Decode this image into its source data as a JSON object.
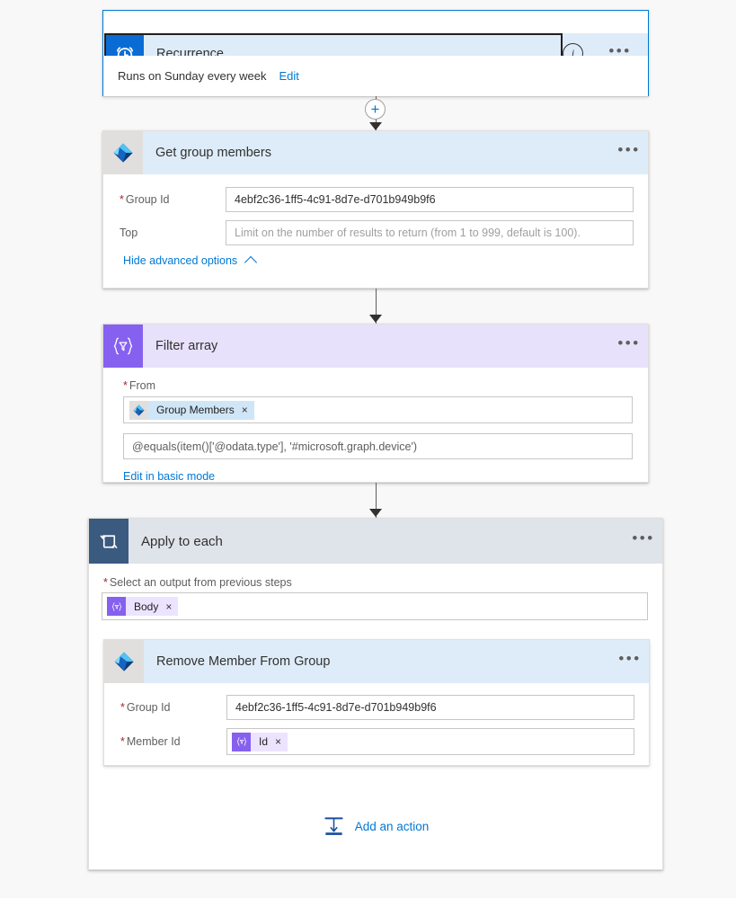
{
  "flow": {
    "trigger": {
      "icon": "alarm-clock-icon",
      "title": "Recurrence",
      "subtitle": "Runs on Sunday every week",
      "edit_label": "Edit",
      "info_glyph": "i",
      "more_glyph": "•••",
      "accent_color": "#0b6bd4",
      "header_bg": "#deecf9",
      "border_color": "#0078d4"
    },
    "connector_plus": {
      "glyph": "+",
      "color": "#0078d4"
    },
    "actions": [
      {
        "id": "get_group_members",
        "icon": "office365-groups-diamond-icon",
        "title": "Get group members",
        "header_bg": "#deecf9",
        "icon_bg": "#e1dfdd",
        "more_glyph": "•••",
        "fields": [
          {
            "label": "Group Id",
            "required": true,
            "value": "4ebf2c36-1ff5-4c91-8d7e-d701b949b9f6",
            "placeholder": ""
          },
          {
            "label": "Top",
            "required": false,
            "value": "",
            "placeholder": "Limit on the number of results to return (from 1 to 999, default is 100)."
          }
        ],
        "advanced_link": "Hide advanced options",
        "advanced_chevron": "chevron-up-icon"
      },
      {
        "id": "filter_array",
        "icon": "filter-braces-icon",
        "title": "Filter array",
        "header_bg": "#e8e1fb",
        "icon_bg": "#8661f0",
        "more_glyph": "•••",
        "from_label": "From",
        "from_required": true,
        "from_token": {
          "text": "Group Members",
          "remove_glyph": "×",
          "style": "blue",
          "icon": "office365-groups-diamond-icon"
        },
        "expression": "@equals(item()['@odata.type'], '#microsoft.graph.device')",
        "basic_mode_link": "Edit in basic mode"
      },
      {
        "id": "apply_to_each",
        "icon": "loop-arrows-icon",
        "title": "Apply to each",
        "header_bg": "#dfe3ea",
        "icon_bg": "#3b5a80",
        "more_glyph": "•••",
        "select_label": "Select an output from previous steps",
        "select_required": true,
        "select_token": {
          "text": "Body",
          "remove_glyph": "×",
          "style": "purple",
          "icon": "filter-braces-icon"
        },
        "nested_action": {
          "id": "remove_member_from_group",
          "icon": "office365-groups-diamond-icon",
          "title": "Remove Member From Group",
          "header_bg": "#deecf9",
          "icon_bg": "#e1dfdd",
          "more_glyph": "•••",
          "fields": [
            {
              "label": "Group Id",
              "required": true,
              "value": "4ebf2c36-1ff5-4c91-8d7e-d701b949b9f6",
              "placeholder": ""
            },
            {
              "label": "Member Id",
              "required": true,
              "token": {
                "text": "Id",
                "remove_glyph": "×",
                "style": "purple",
                "icon": "filter-braces-icon"
              }
            }
          ]
        },
        "add_action": {
          "label": "Add an action",
          "icon": "insert-action-icon",
          "color": "#0078d4"
        }
      }
    ]
  }
}
